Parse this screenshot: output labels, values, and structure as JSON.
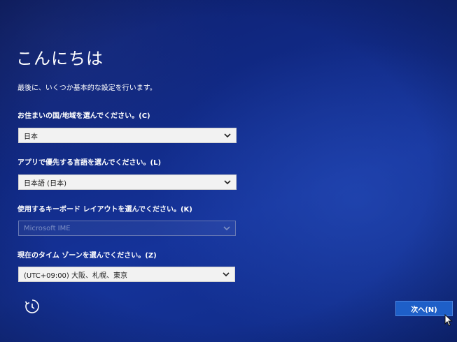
{
  "header": {
    "title": "こんにちは",
    "subtitle": "最後に、いくつか基本的な設定を行います。"
  },
  "fields": [
    {
      "label": "お住まいの国/地域を選んでください。(C)",
      "value": "日本",
      "disabled": false
    },
    {
      "label": "アプリで優先する言語を選んでください。(L)",
      "value": "日本語 (日本)",
      "disabled": false
    },
    {
      "label": "使用するキーボード レイアウトを選んでください。(K)",
      "value": "Microsoft IME",
      "disabled": true
    },
    {
      "label": "現在のタイム ゾーンを選んでください。(Z)",
      "value": "(UTC+09:00) 大阪、札幌、東京",
      "disabled": false
    }
  ],
  "footer": {
    "next_label": "次へ(N)",
    "restart_icon": "restart-icon",
    "cursor_icon": "mouse-pointer-icon"
  },
  "colors": {
    "background": "#112a86",
    "next_button": "#1e5fc8",
    "select_bg": "#f2f2f2"
  }
}
